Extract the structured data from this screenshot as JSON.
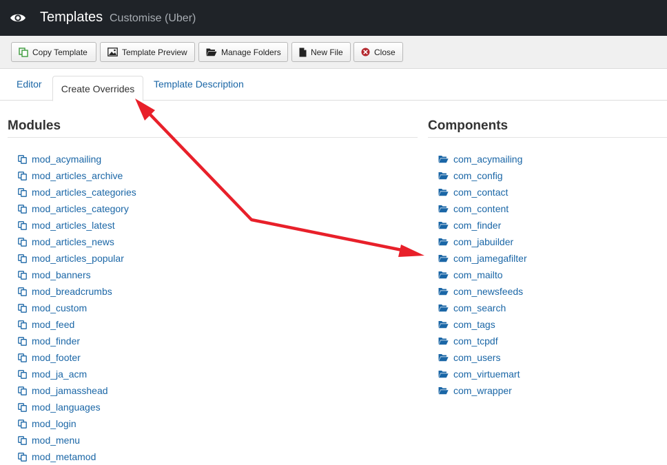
{
  "header": {
    "icon": "eye-icon",
    "title": "Templates",
    "subtitle": "Customise (Uber)"
  },
  "toolbar": {
    "buttons": [
      {
        "label": "Copy Template",
        "icon": "copy-icon"
      },
      {
        "label": "Template Preview",
        "icon": "image-icon"
      },
      {
        "label": "Manage Folders",
        "icon": "folder-open-icon"
      },
      {
        "label": "New File",
        "icon": "file-icon"
      },
      {
        "label": "Close",
        "icon": "close-circle-icon"
      }
    ]
  },
  "tabs": [
    {
      "label": "Editor",
      "active": false
    },
    {
      "label": "Create Overrides",
      "active": true
    },
    {
      "label": "Template Description",
      "active": false
    }
  ],
  "modules": {
    "title": "Modules",
    "items": [
      "mod_acymailing",
      "mod_articles_archive",
      "mod_articles_categories",
      "mod_articles_category",
      "mod_articles_latest",
      "mod_articles_news",
      "mod_articles_popular",
      "mod_banners",
      "mod_breadcrumbs",
      "mod_custom",
      "mod_feed",
      "mod_finder",
      "mod_footer",
      "mod_ja_acm",
      "mod_jamasshead",
      "mod_languages",
      "mod_login",
      "mod_menu",
      "mod_metamod"
    ]
  },
  "components": {
    "title": "Components",
    "items": [
      "com_acymailing",
      "com_config",
      "com_contact",
      "com_content",
      "com_finder",
      "com_jabuilder",
      "com_jamegafilter",
      "com_mailto",
      "com_newsfeeds",
      "com_search",
      "com_tags",
      "com_tcpdf",
      "com_users",
      "com_virtuemart",
      "com_wrapper"
    ]
  },
  "colors": {
    "header_bg": "#1f2328",
    "link": "#1a66a6",
    "arrow": "#e8202a",
    "close_icon": "#b4282e"
  }
}
